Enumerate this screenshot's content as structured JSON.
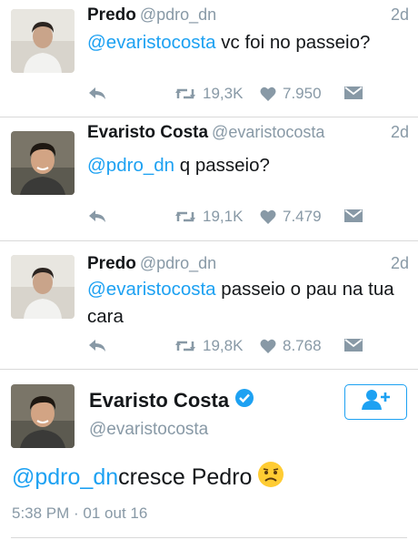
{
  "tweets": [
    {
      "name": "Predo",
      "handle": "@pdro_dn",
      "time": "2d",
      "mention": "@evaristocosta",
      "text_line1": " vc foi no passeio?",
      "text_line2": "",
      "retweets": "19,3K",
      "likes": "7.950"
    },
    {
      "name": "Evaristo Costa",
      "handle": "@evaristocosta",
      "time": "2d",
      "mention": "@pdro_dn",
      "text_line1": " q passeio?",
      "text_line2": "",
      "retweets": "19,1K",
      "likes": "7.479"
    },
    {
      "name": "Predo",
      "handle": "@pdro_dn",
      "time": "2d",
      "mention": "@evaristocosta",
      "text_line1": " passeio o pau na tua",
      "text_line2": "cara",
      "retweets": "19,8K",
      "likes": "8.768"
    }
  ],
  "main_tweet": {
    "name": "Evaristo Costa",
    "handle": "@evaristocosta",
    "mention": "@pdro_dn",
    "text": " cresce Pedro",
    "emoji": "frowning-face",
    "timestamp": "5:38 PM · 01 out 16"
  },
  "icons": {
    "reply": "reply-icon",
    "retweet": "retweet-icon",
    "like": "heart-icon",
    "dm": "direct-message-icon",
    "verified": "verified-badge-icon",
    "follow": "follow-user-icon"
  },
  "colors": {
    "accent": "#1da1f2",
    "muted": "#8899a6",
    "text": "#14171a"
  }
}
